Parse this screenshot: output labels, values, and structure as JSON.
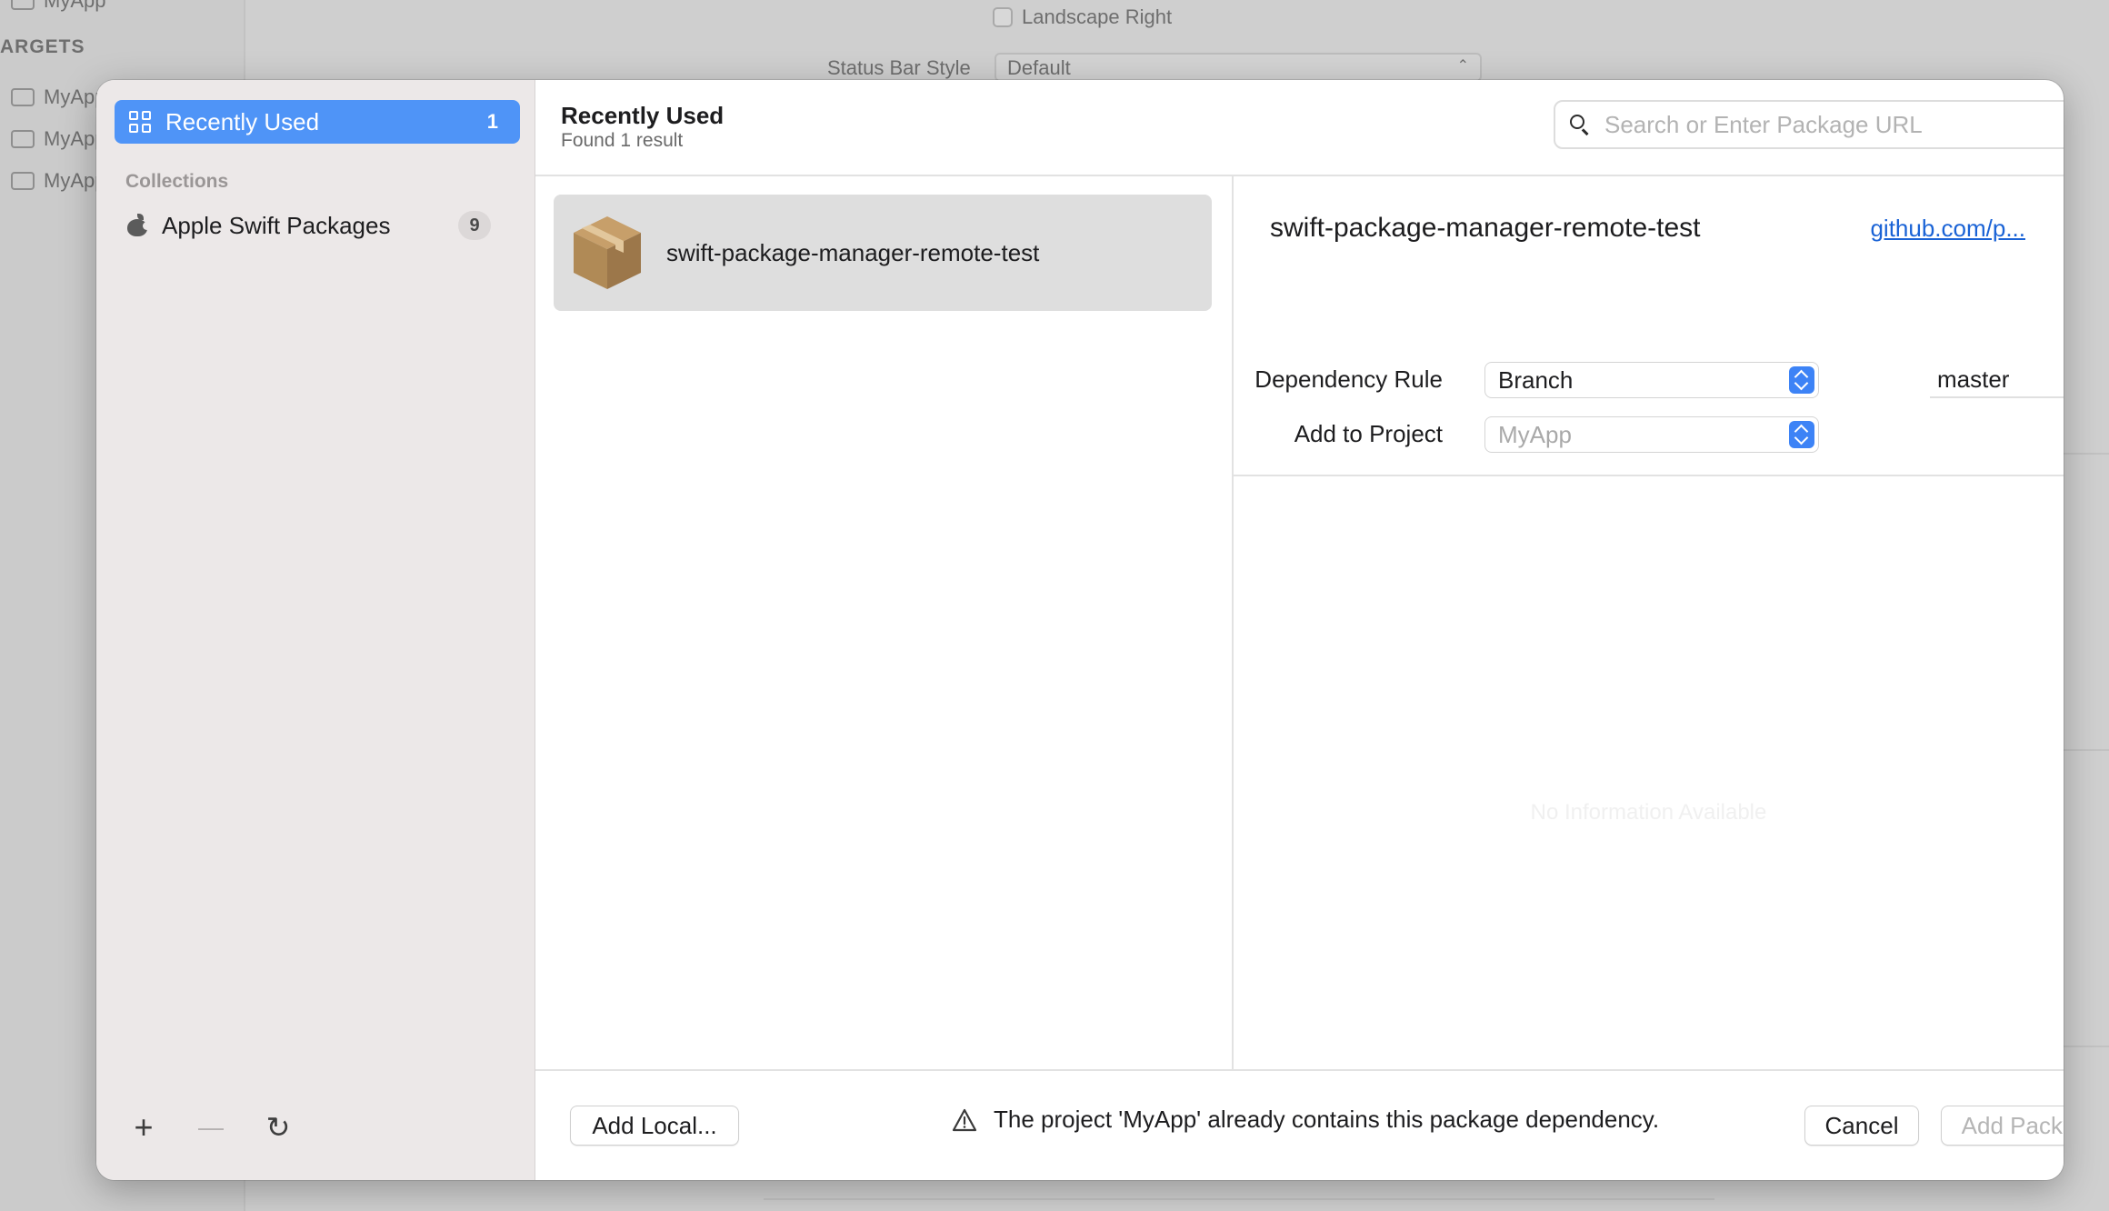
{
  "background": {
    "sidebar_items": [
      "MyApp",
      "MyApp",
      "MyApp",
      "MyApp"
    ],
    "section_label": "ARGETS",
    "landscape_right": "Landscape Right",
    "status_bar_style_label": "Status Bar Style",
    "status_bar_style_value": "Default"
  },
  "sidebar": {
    "selected": {
      "label": "Recently Used",
      "count": "1",
      "icon": "grid-icon"
    },
    "collections_heading": "Collections",
    "collections": [
      {
        "label": "Apple Swift Packages",
        "count": "9",
        "icon": "apple-logo-icon"
      }
    ],
    "bottom_actions": [
      {
        "name": "add",
        "glyph": "+"
      },
      {
        "name": "remove",
        "glyph": "—"
      },
      {
        "name": "refresh",
        "glyph": "↻"
      }
    ]
  },
  "header": {
    "title": "Recently Used",
    "subtitle": "Found 1 result",
    "search_placeholder": "Search or Enter Package URL"
  },
  "results": [
    {
      "name": "swift-package-manager-remote-test",
      "icon": "package-box-icon"
    }
  ],
  "detail": {
    "title": "swift-package-manager-remote-test",
    "link": "github.com/p...",
    "dependency_rule_label": "Dependency Rule",
    "dependency_rule_value": "Branch",
    "branch_value": "master",
    "add_to_project_label": "Add to Project",
    "add_to_project_value": "MyApp",
    "empty_text": "No Information Available"
  },
  "footer": {
    "add_local_label": "Add Local...",
    "warning": "The project 'MyApp' already contains this package dependency.",
    "cancel_label": "Cancel",
    "add_package_label": "Add Package"
  },
  "colors": {
    "accent": "#4f94f7",
    "link": "#1a63d6",
    "package_brown": "#b08a56"
  }
}
